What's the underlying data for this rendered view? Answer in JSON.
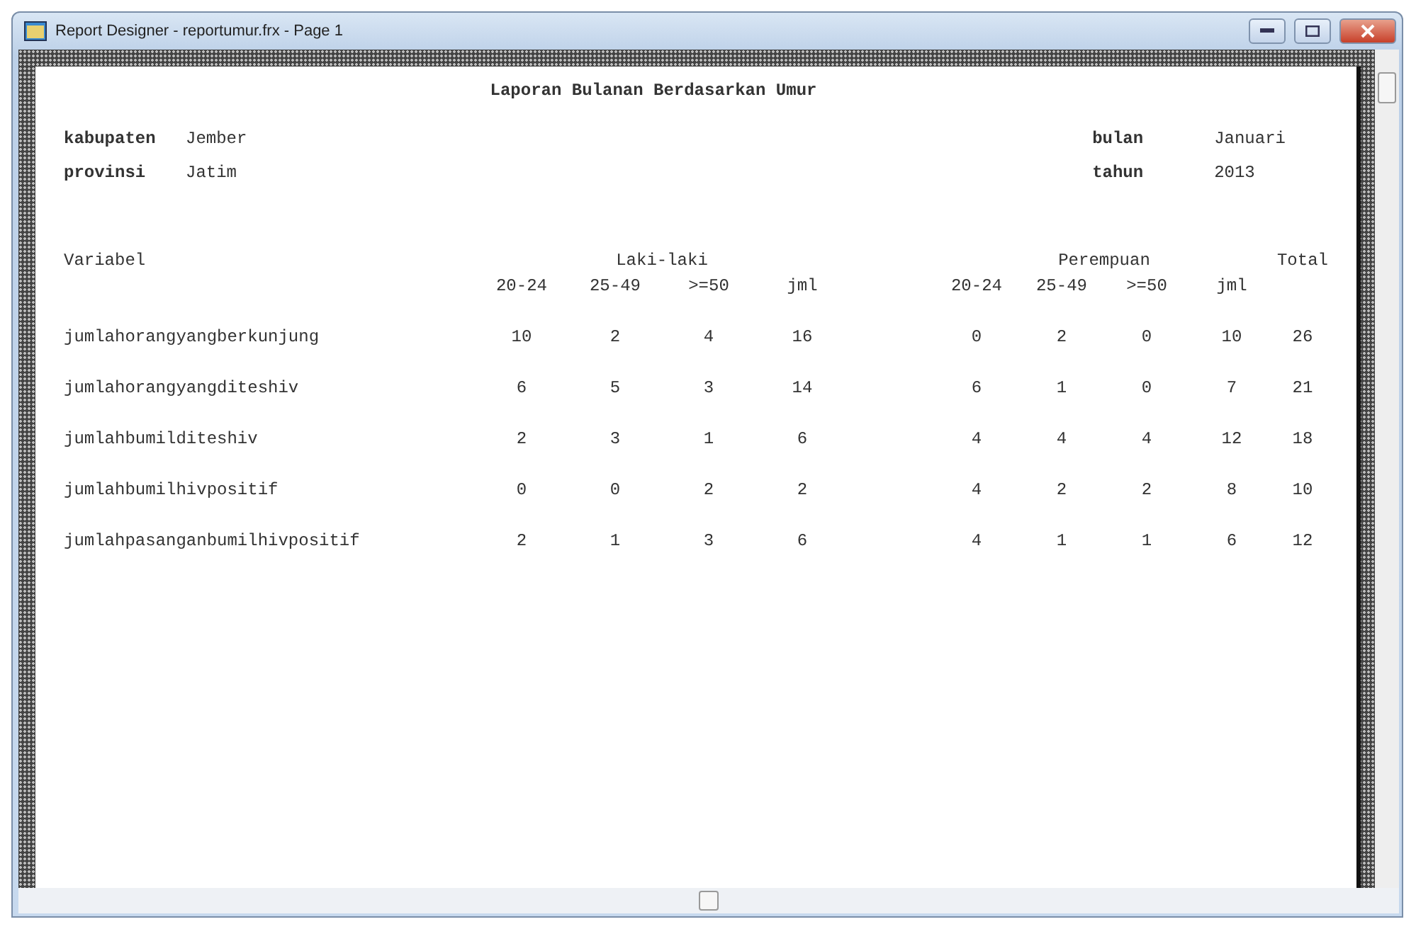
{
  "window": {
    "title": "Report Designer - reportumur.frx - Page 1"
  },
  "report": {
    "title": "Laporan Bulanan Berdasarkan Umur",
    "fields_left": [
      {
        "label": "kabupaten",
        "value": "Jember"
      },
      {
        "label": "provinsi",
        "value": "Jatim"
      }
    ],
    "fields_right": [
      {
        "label": "bulan",
        "value": "Januari"
      },
      {
        "label": "tahun",
        "value": "2013"
      }
    ],
    "table": {
      "label_header": "Variabel",
      "group_headers": [
        "Laki-laki",
        "Perempuan"
      ],
      "total_header": "Total",
      "columns": [
        "20-24",
        "25-49",
        ">=50",
        "jml",
        "20-24",
        "25-49",
        ">=50",
        "jml"
      ],
      "rows": [
        {
          "label": "jumlahorangyangberkunjung",
          "cells": [
            "10",
            "2",
            "4",
            "16",
            "0",
            "2",
            "0",
            "10",
            "26"
          ]
        },
        {
          "label": "jumlahorangyangditeshiv",
          "cells": [
            "6",
            "5",
            "3",
            "14",
            "6",
            "1",
            "0",
            "7",
            "21"
          ]
        },
        {
          "label": "jumlahbumilditeshiv",
          "cells": [
            "2",
            "3",
            "1",
            "6",
            "4",
            "4",
            "4",
            "12",
            "18"
          ]
        },
        {
          "label": "jumlahbumilhivpositif",
          "cells": [
            "0",
            "0",
            "2",
            "2",
            "4",
            "2",
            "2",
            "8",
            "10"
          ]
        },
        {
          "label": "jumlahpasanganbumilhivpositif",
          "cells": [
            "2",
            "1",
            "3",
            "6",
            "4",
            "1",
            "1",
            "6",
            "12"
          ]
        }
      ]
    }
  }
}
